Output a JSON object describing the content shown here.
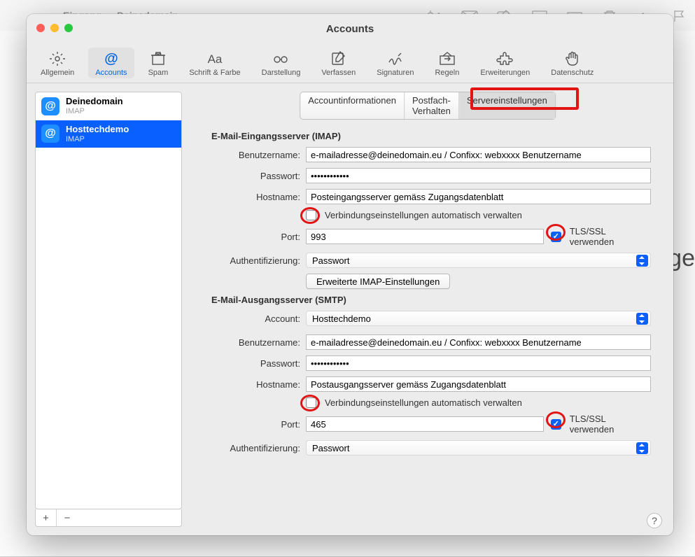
{
  "background": {
    "title": "Eingang — Deinedomain",
    "right_text": "sge"
  },
  "modal_title": "Accounts",
  "toolbar": [
    {
      "id": "general",
      "label": "Allgemein"
    },
    {
      "id": "accounts",
      "label": "Accounts"
    },
    {
      "id": "spam",
      "label": "Spam"
    },
    {
      "id": "fonts",
      "label": "Schrift & Farbe"
    },
    {
      "id": "view",
      "label": "Darstellung"
    },
    {
      "id": "compose",
      "label": "Verfassen"
    },
    {
      "id": "signatures",
      "label": "Signaturen"
    },
    {
      "id": "rules",
      "label": "Regeln"
    },
    {
      "id": "extensions",
      "label": "Erweiterungen"
    },
    {
      "id": "privacy",
      "label": "Datenschutz"
    }
  ],
  "accounts": [
    {
      "name": "Deinedomain",
      "proto": "IMAP"
    },
    {
      "name": "Hosttechdemo",
      "proto": "IMAP"
    }
  ],
  "tabs": {
    "info": "Accountinformationen",
    "mailbox": "Postfach-Verhalten",
    "server": "Servereinstellungen"
  },
  "incoming": {
    "title": "E-Mail-Eingangsserver (IMAP)",
    "labels": {
      "user": "Benutzername:",
      "pass": "Passwort:",
      "host": "Hostname:",
      "port": "Port:",
      "auth": "Authentifizierung:"
    },
    "user": "e-mailadresse@deinedomain.eu / Confixx: webxxxx Benutzername",
    "pass": "••••••••••••",
    "host": "Posteingangsserver gemäss Zugangsdatenblatt",
    "auto": "Verbindungseinstellungen automatisch verwalten",
    "port": "993",
    "tls": "TLS/SSL verwenden",
    "auth": "Passwort",
    "advanced": "Erweiterte IMAP-Einstellungen"
  },
  "outgoing": {
    "title": "E-Mail-Ausgangsserver (SMTP)",
    "labels": {
      "account": "Account:",
      "user": "Benutzername:",
      "pass": "Passwort:",
      "host": "Hostname:",
      "port": "Port:",
      "auth": "Authentifizierung:"
    },
    "account": "Hosttechdemo",
    "user": "e-mailadresse@deinedomain.eu / Confixx: webxxxx Benutzername",
    "pass": "••••••••••••",
    "host": "Postausgangsserver gemäss Zugangsdatenblatt",
    "auto": "Verbindungseinstellungen automatisch verwalten",
    "port": "465",
    "tls": "TLS/SSL verwenden",
    "auth": "Passwort"
  },
  "buttons": {
    "plus": "+",
    "minus": "−",
    "help": "?"
  }
}
